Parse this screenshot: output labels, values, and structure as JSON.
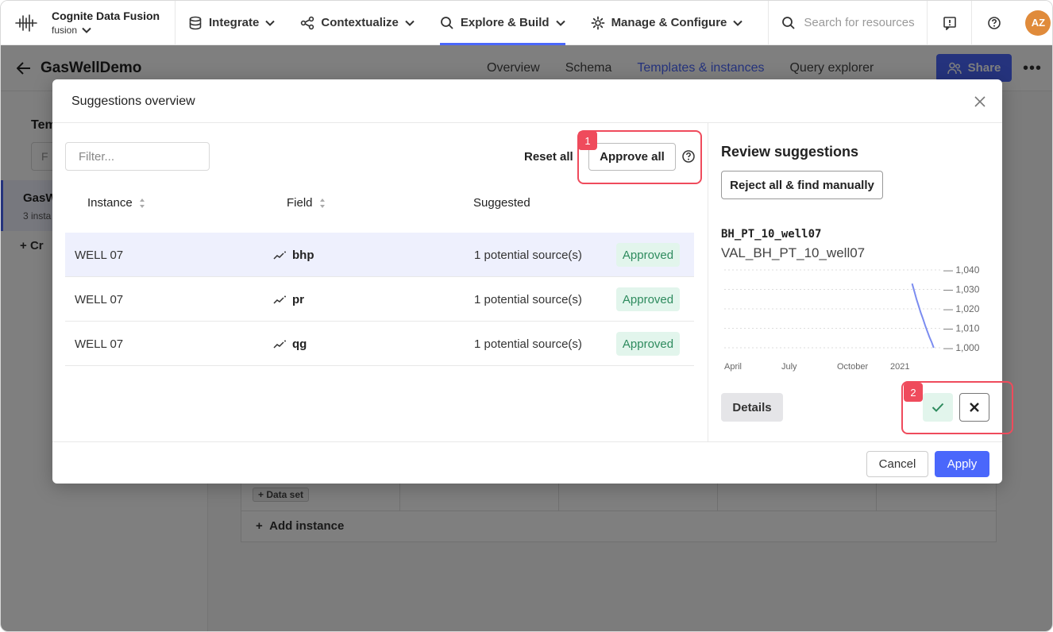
{
  "topnav": {
    "brand_name": "Cognite Data Fusion",
    "brand_sub": "fusion",
    "items": [
      {
        "label": "Integrate",
        "icon": "database-icon"
      },
      {
        "label": "Contextualize",
        "icon": "share-nodes-icon"
      },
      {
        "label": "Explore & Build",
        "icon": "search-icon"
      },
      {
        "label": "Manage & Configure",
        "icon": "gear-icon"
      }
    ],
    "active_item": "Explore & Build",
    "search_placeholder": "Search for resources",
    "avatar_initials": "AZ"
  },
  "subheader": {
    "title": "GasWellDemo",
    "tabs": [
      "Overview",
      "Schema",
      "Templates & instances",
      "Query explorer"
    ],
    "active_tab": "Templates & instances",
    "share_label": "Share"
  },
  "background": {
    "left_title": "Tem",
    "filter_placeholder": "F",
    "item_name": "GasW",
    "item_sub": "3 insta",
    "create_label": "Cr",
    "dataset_tag": "+ Data set",
    "add_instance": "Add instance"
  },
  "modal": {
    "title": "Suggestions overview",
    "filter_placeholder": "Filter...",
    "reset_all": "Reset all",
    "approve_all": "Approve all",
    "columns": {
      "instance": "Instance",
      "field": "Field",
      "suggested": "Suggested"
    },
    "rows": [
      {
        "instance": "WELL 07",
        "field": "bhp",
        "suggested": "1 potential source(s)",
        "status": "Approved"
      },
      {
        "instance": "WELL 07",
        "field": "pr",
        "suggested": "1 potential source(s)",
        "status": "Approved"
      },
      {
        "instance": "WELL 07",
        "field": "qg",
        "suggested": "1 potential source(s)",
        "status": "Approved"
      }
    ],
    "review": {
      "title": "Review suggestions",
      "reject_all": "Reject all & find manually",
      "timeseries_name": "BH_PT_10_well07",
      "timeseries_external_id": "VAL_BH_PT_10_well07",
      "details": "Details"
    },
    "cancel": "Cancel",
    "apply": "Apply"
  },
  "chart_data": {
    "type": "line",
    "x_ticks": [
      "April",
      "July",
      "October",
      "2021"
    ],
    "y_ticks": [
      "1,040",
      "1,030",
      "1,020",
      "1,010",
      "1,000"
    ],
    "ylim": [
      1000,
      1040
    ],
    "x": [
      0.87,
      0.88,
      0.89,
      0.9,
      0.91,
      0.92,
      0.93,
      0.94,
      0.95,
      0.96,
      0.97
    ],
    "series": [
      {
        "values": [
          1033,
          1029,
          1025,
          1021.5,
          1018,
          1015,
          1011.5,
          1008.5,
          1005.5,
          1003,
          1000
        ]
      }
    ],
    "xlim": [
      0,
      1
    ],
    "grid": true,
    "color": "#7b8cf0"
  },
  "callouts": [
    "1",
    "2"
  ],
  "colors": {
    "accent": "#4a67fb",
    "approved_bg": "#e2f5ec",
    "approved_text": "#2e8b5e",
    "callout": "#ef4b5c"
  }
}
